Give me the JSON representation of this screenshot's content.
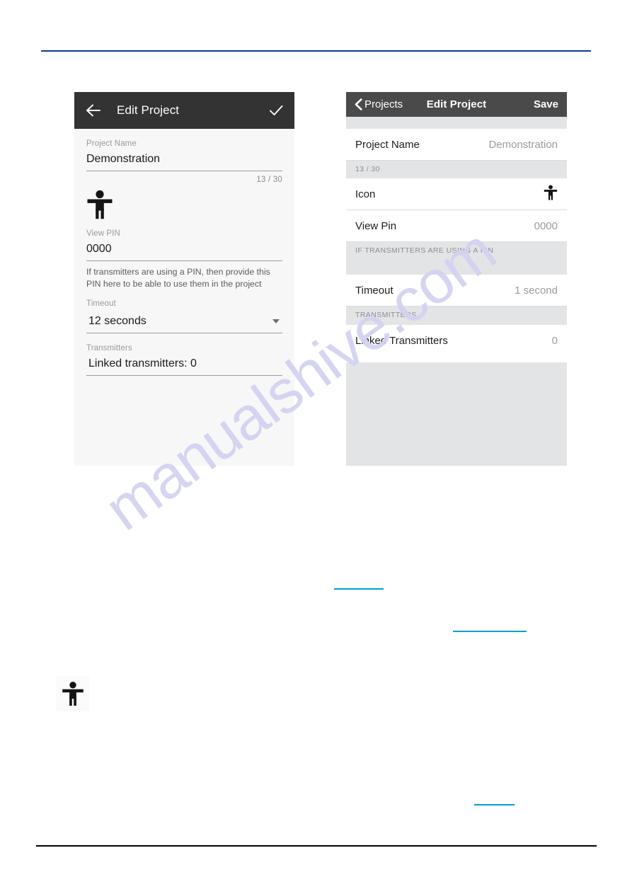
{
  "page": {
    "background_color": "#ffffff",
    "top_rule_color": "#0b3d91",
    "bottom_rule_color": "#000000",
    "watermark_text": "manualshive.com",
    "watermark_color": "#d3d3f2",
    "link_underline_color": "#00a0c6"
  },
  "android_screenshot": {
    "appbar": {
      "back_icon": "arrow-left-icon",
      "title": "Edit Project",
      "confirm_icon": "check-icon",
      "background_color": "#333333",
      "text_color": "#ffffff"
    },
    "fields": {
      "project_name_label": "Project Name",
      "project_name_value": "Demonstration",
      "char_counter": "13 / 30",
      "icon_name": "accessibility-icon",
      "view_pin_label": "View PIN",
      "view_pin_value": "0000",
      "pin_helper_text": "If transmitters are using a PIN, then provide this PIN here to be able to use them in the project",
      "timeout_label": "Timeout",
      "timeout_value": "12 seconds",
      "timeout_dropdown_icon": "chevron-down-icon",
      "transmitters_label": "Transmitters",
      "transmitters_value": "Linked transmitters: 0"
    }
  },
  "ios_screenshot": {
    "navbar": {
      "back_icon": "chevron-left-icon",
      "back_label": "Projects",
      "title": "Edit Project",
      "save_label": "Save",
      "background_color": "#4a4a4a",
      "text_color": "#ffffff"
    },
    "rows": [
      {
        "label": "Project Name",
        "value": "Demonstration",
        "type": "text"
      },
      {
        "label": "Icon",
        "value": "",
        "type": "icon",
        "icon_name": "accessibility-icon"
      },
      {
        "label": "View Pin",
        "value": "0000",
        "type": "text"
      },
      {
        "label": "Timeout",
        "value": "1 second",
        "type": "text"
      },
      {
        "label": "Linked Transmitters",
        "value": "0",
        "type": "text"
      }
    ],
    "sections": {
      "char_counter": "13 / 30",
      "pin_hint": "IF TRANSMITTERS ARE USING A PIN",
      "transmitters_header": "TRANSMITTERS"
    },
    "section_background_color": "#e3e4e6"
  },
  "standalone_icon": {
    "icon_name": "accessibility-icon",
    "description": ""
  }
}
